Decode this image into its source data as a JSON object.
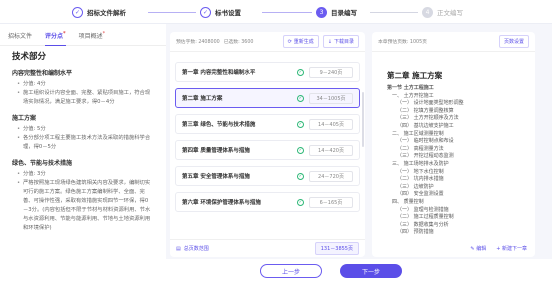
{
  "steps": [
    {
      "num": "✓",
      "label": "招标文件解析",
      "state": "done"
    },
    {
      "num": "✓",
      "label": "标书设置",
      "state": "done"
    },
    {
      "num": "3",
      "label": "目录编写",
      "state": "current"
    },
    {
      "num": "4",
      "label": "正文编写",
      "state": "todo"
    }
  ],
  "left": {
    "tabs": [
      {
        "label": "招标文件",
        "mark": ""
      },
      {
        "label": "评分点",
        "mark": "*"
      },
      {
        "label": "项目概述",
        "mark": "*"
      }
    ],
    "title": "技术部分",
    "sections": [
      {
        "heading": "内容完整性和编制水平",
        "bullets": [
          "分值: 4分",
          "施工组织设计内容全面、完整、紧贴项目施工，符合现场实际情况，满足施工要求，得0－4分"
        ]
      },
      {
        "heading": "施工方案",
        "bullets": [
          "分值: 5分",
          "各分部分项工程主要施工技术方法及采取的措施科学合理，得0－5分"
        ]
      },
      {
        "heading": "绿色、节能与技术措施",
        "bullets": [
          "分值: 3分",
          "严格按照施工现场绿色建筑相关内容及要求，编制切实可行的施工方案。绿色施工方案编制科学、全面、完善、可操作性强，采取有效措施实现四节一环保，得0－3分。(内容包括但不限于节材与材料资源利用、节水与水资源利用、节能与能源利用、节地与土地资源利用和环境保护)"
        ]
      }
    ]
  },
  "mid": {
    "word_count": "预估字数: 2408000",
    "selected_count": "已选数: 3600",
    "regen_label": "重新生成",
    "download_label": "下载目录",
    "chapters": [
      {
        "title": "第一章 内容完整性和编制水平",
        "range": "9－240页",
        "selected": false
      },
      {
        "title": "第二章 施工方案",
        "range": "34－1005页",
        "selected": true
      },
      {
        "title": "第三章 绿色、节能与技术措施",
        "range": "14－405页",
        "selected": false
      },
      {
        "title": "第四章 质量管理体系与措施",
        "range": "14－420页",
        "selected": false
      },
      {
        "title": "第五章 安全管理体系与措施",
        "range": "24－720页",
        "selected": false
      },
      {
        "title": "第六章 环境保护管理体系与措施",
        "range": "6－165页",
        "selected": false
      }
    ],
    "total_label": "总页数范围",
    "total_range": "131－3855页"
  },
  "right": {
    "word_count": "本章预估页数: 1005页",
    "btn_label": "页数设置",
    "title": "第二章 施工方案",
    "toc": [
      {
        "text": "第一节 土方工程施工",
        "indent": 0
      },
      {
        "text": "一、 土方开挖施工",
        "indent": 1
      },
      {
        "text": "（一） 设计地面类型地形调整",
        "indent": 2
      },
      {
        "text": "（二） 挖填方量调整核算",
        "indent": 2
      },
      {
        "text": "（三） 土方开挖顺序及方法",
        "indent": 2
      },
      {
        "text": "（四） 基坑边坡支护施工",
        "indent": 2
      },
      {
        "text": "二、 施工区域测量控制",
        "indent": 1
      },
      {
        "text": "（一） 临时控制点和布设",
        "indent": 2
      },
      {
        "text": "（二） 高程测量方法",
        "indent": 2
      },
      {
        "text": "（三） 开挖过程动态监测",
        "indent": 2
      },
      {
        "text": "三、 施工场地排水及防护",
        "indent": 1
      },
      {
        "text": "（一） 地下水位控制",
        "indent": 2
      },
      {
        "text": "（二） 坑内排水措施",
        "indent": 2
      },
      {
        "text": "（三） 边坡防护",
        "indent": 2
      },
      {
        "text": "（四） 安全监测设置",
        "indent": 2
      },
      {
        "text": "四、 质量控制",
        "indent": 1
      },
      {
        "text": "（一） 监理与检测措施",
        "indent": 2
      },
      {
        "text": "（二） 施工过程质量控制",
        "indent": 2
      },
      {
        "text": "（三） 数据收集与分析",
        "indent": 2
      },
      {
        "text": "（四） 预防措施",
        "indent": 2
      }
    ],
    "edit_label": "编辑",
    "add_label": "新建下一章"
  },
  "nav": {
    "prev_label": "上一步",
    "next_label": "下一步"
  }
}
